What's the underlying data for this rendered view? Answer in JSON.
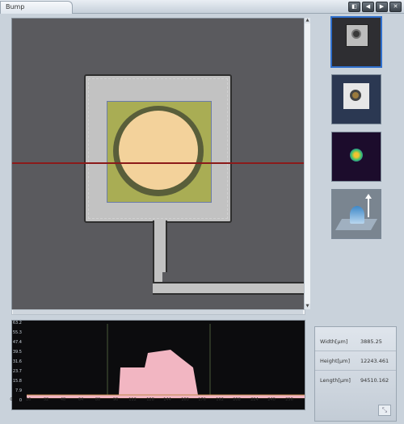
{
  "window": {
    "tab_label": "Bump",
    "buttons": [
      "◧",
      "◀",
      "▶",
      "✕"
    ]
  },
  "profile": {
    "y_ticks": [
      "63.2",
      "55.3",
      "47.4",
      "39.5",
      "31.6",
      "23.7",
      "15.8",
      "7.9",
      "0"
    ],
    "x_ticks": [
      "0",
      "16",
      "32",
      "48",
      "64",
      "80",
      "96",
      "112",
      "128",
      "144",
      "160",
      "176",
      "192",
      "208",
      "224",
      "240",
      "256"
    ]
  },
  "measurements": {
    "width_label": "Width[μm]",
    "width_value": "3885.25",
    "height_label": "Height[μm]",
    "height_value": "12243.461",
    "length_label": "Length[μm]",
    "length_value": "94510.162"
  },
  "colors": {
    "accent": "#2f6fcc",
    "profile_fill": "#f2b6c2",
    "line_cursor": "#8b1a1a"
  }
}
